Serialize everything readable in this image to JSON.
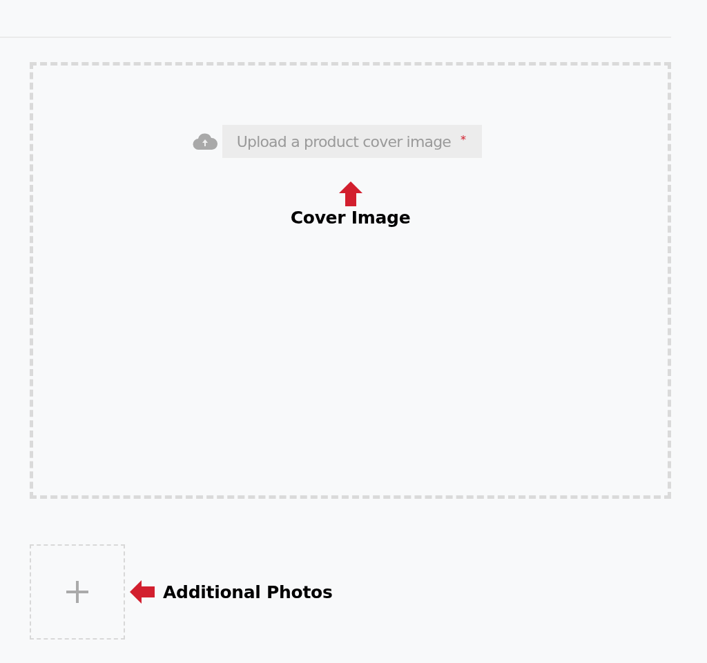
{
  "cover_image": {
    "upload_label": "Upload a product cover image",
    "required_mark": "*",
    "annotation": "Cover Image"
  },
  "additional_photos": {
    "annotation": "Additional Photos"
  }
}
